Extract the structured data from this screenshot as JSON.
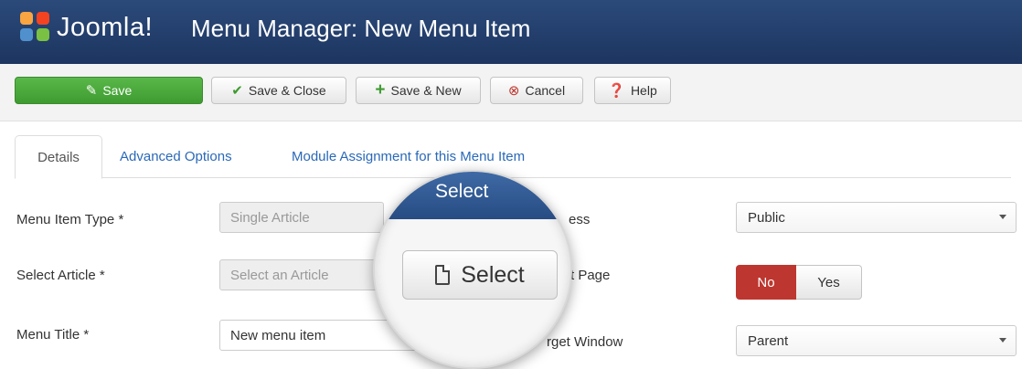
{
  "header": {
    "logo_text": "Joomla!",
    "title": "Menu Manager: New Menu Item"
  },
  "toolbar": {
    "save": "Save",
    "save_close": "Save & Close",
    "save_new": "Save & New",
    "cancel": "Cancel",
    "help": "Help"
  },
  "tabs": [
    {
      "label": "Details",
      "active": true
    },
    {
      "label": "Advanced Options",
      "active": false
    },
    {
      "label": "Module Assignment for this Menu Item",
      "active": false
    }
  ],
  "form": {
    "menu_item_type_label": "Menu Item Type *",
    "menu_item_type_value": "Single Article",
    "select_article_label": "Select Article *",
    "select_article_placeholder": "Select an Article",
    "menu_title_label": "Menu Title *",
    "menu_title_value": "New menu item",
    "access_label_partial": "ess",
    "access_value": "Public",
    "default_page_label_partial": "t Page",
    "default_page_no": "No",
    "default_page_yes": "Yes",
    "target_window_label_partial": "rget Window",
    "target_window_value": "Parent"
  },
  "magnifier": {
    "band_title": "Select",
    "select_button": "Select"
  },
  "colors": {
    "header_bg": "#1d3560",
    "save_green": "#3e9b30",
    "no_red": "#bd362f",
    "link_blue": "#2a69b8"
  }
}
